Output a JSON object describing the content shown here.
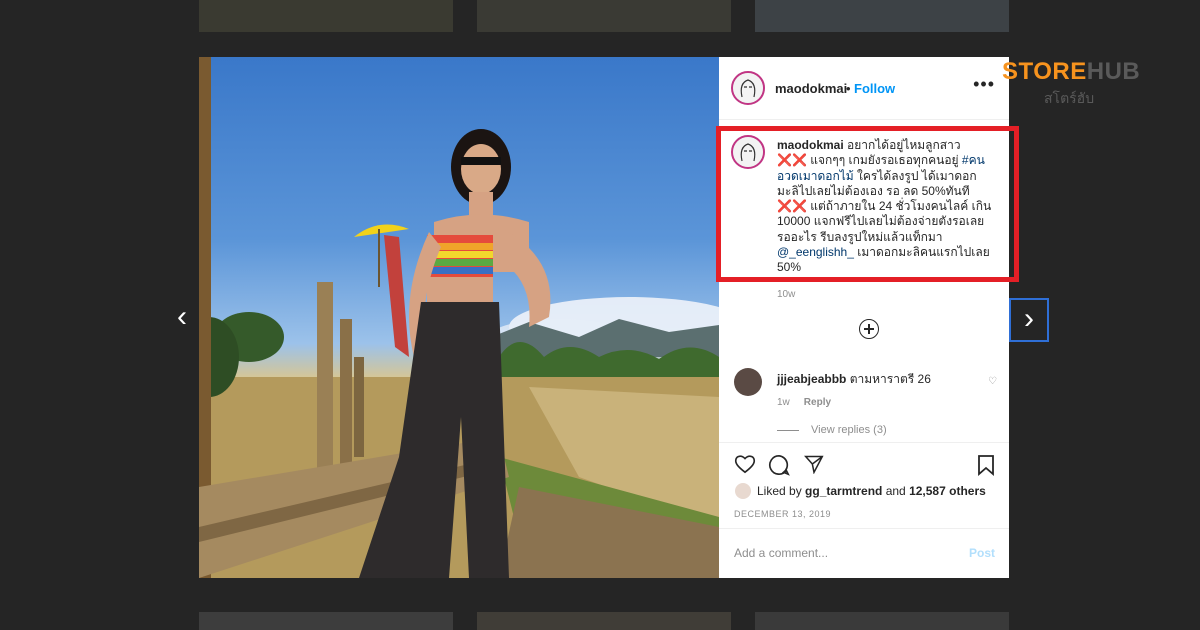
{
  "post": {
    "username": "maodokmai",
    "follow_label": "Follow",
    "more_label": "•••",
    "caption": {
      "username": "maodokmai",
      "line1": " อยากได้อยู่ไหมลูกสาว",
      "marks1": "❌❌",
      "line2": " แจกๆๆ เกมยังรอเธอทุกคนอยู่ ",
      "hashtag": "#คนอวดเมาดอกไม้",
      "line3": " ใครได้ลงรูป ได้เมาดอกมะลิไปเลยไม่ต้องเอง รอ ลด 50%ทันที ",
      "marks2": "❌❌",
      "line4": " แต่ถ้าภายใน 24 ชั่วโมงคนไลค์ เกิน 10000 แจกฟรีไปเลยไม่ต้องจ่ายตังรอเลยรออะไร รีบลงรูปใหม่แล้วแท็กมา ",
      "mention": "@_eenglishh_",
      "line5": " เมาดอกมะลิคนแรกไปเลย 50%"
    },
    "time_ago": "10w",
    "comment": {
      "username": "jjjeabjeabbb",
      "text": " ตามหาราตรี 26",
      "time": "1w",
      "reply_label": "Reply",
      "view_replies": "View replies (3)"
    },
    "likes": {
      "prefix": "Liked by ",
      "user": "gg_tarmtrend",
      "middle": " and ",
      "count": "12,587 others"
    },
    "date": "DECEMBER 13, 2019",
    "add_comment_placeholder": "Add a comment...",
    "post_button": "Post"
  },
  "nav": {
    "prev": "‹",
    "next": "›"
  },
  "brand": {
    "part1": "STORE",
    "part2": "HUB",
    "subtitle": "สโตร์ฮับ"
  },
  "colors": {
    "highlight": "#e41f26",
    "brand_orange": "#f7931e",
    "link": "#0095f6"
  },
  "icons": [
    "heart-icon",
    "comment-icon",
    "share-icon",
    "bookmark-icon",
    "add-icon",
    "more-icon"
  ]
}
